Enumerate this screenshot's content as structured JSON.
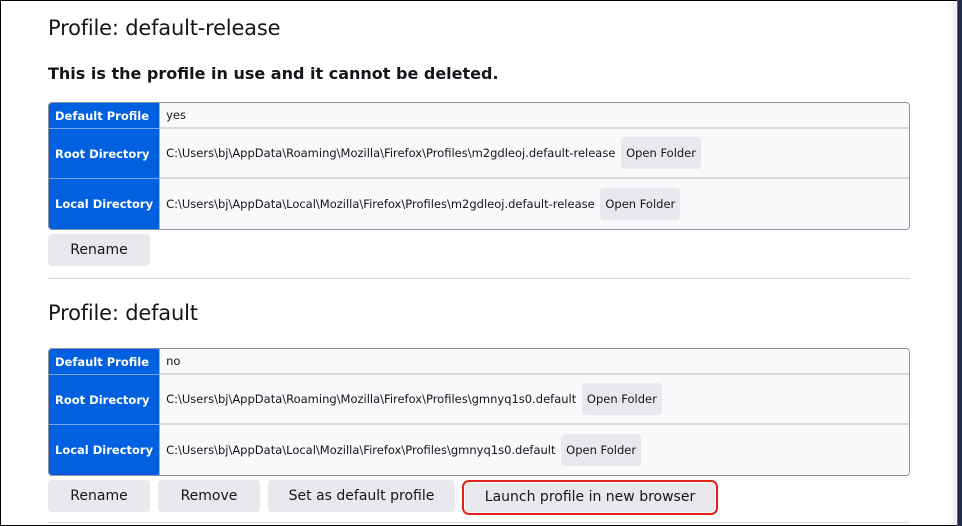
{
  "profiles": [
    {
      "title": "Profile: default-release",
      "in_use_notice": "This is the profile in use and it cannot be deleted.",
      "rows": {
        "default_profile": {
          "label": "Default Profile",
          "value": "yes"
        },
        "root_directory": {
          "label": "Root Directory",
          "value": "C:\\Users\\bj\\AppData\\Roaming\\Mozilla\\Firefox\\Profiles\\m2gdleoj.default-release",
          "button": "Open Folder"
        },
        "local_directory": {
          "label": "Local Directory",
          "value": "C:\\Users\\bj\\AppData\\Local\\Mozilla\\Firefox\\Profiles\\m2gdleoj.default-release",
          "button": "Open Folder"
        }
      },
      "actions": {
        "rename": "Rename"
      }
    },
    {
      "title": "Profile: default",
      "rows": {
        "default_profile": {
          "label": "Default Profile",
          "value": "no"
        },
        "root_directory": {
          "label": "Root Directory",
          "value": "C:\\Users\\bj\\AppData\\Roaming\\Mozilla\\Firefox\\Profiles\\gmnyq1s0.default",
          "button": "Open Folder"
        },
        "local_directory": {
          "label": "Local Directory",
          "value": "C:\\Users\\bj\\AppData\\Local\\Mozilla\\Firefox\\Profiles\\gmnyq1s0.default",
          "button": "Open Folder"
        }
      },
      "actions": {
        "rename": "Rename",
        "remove": "Remove",
        "set_default": "Set as default profile",
        "launch": "Launch profile in new browser"
      }
    }
  ],
  "colors": {
    "header_cell": "#0060df",
    "highlight": "#e22018",
    "button_bg": "#e9e9ed"
  }
}
